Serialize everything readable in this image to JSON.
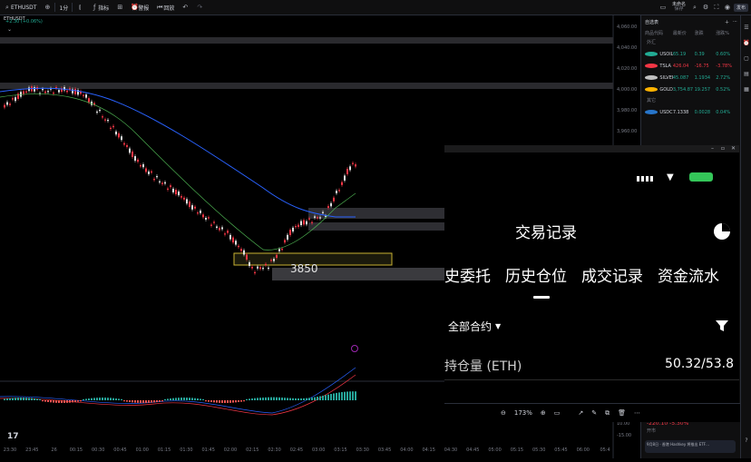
{
  "toolbar": {
    "symbol": "ETHUSDT",
    "interval": "1分",
    "indicators": "指标",
    "templates_icon": "grid-icon",
    "alert": "警报",
    "replay": "回放",
    "layout_name": "未命名",
    "layout_sub": "保存",
    "publish": "发布"
  },
  "chart": {
    "change_text": "+2.30 (+0.06%)",
    "price_axis": [
      "4,060.00",
      "4,040.00",
      "4,020.00",
      "4,000.00",
      "3,980.00",
      "3,960.00"
    ],
    "time_axis": [
      "23:30",
      "23:45",
      "26",
      "00:15",
      "00:30",
      "00:45",
      "01:00",
      "01:15",
      "01:30",
      "01:45",
      "02:00",
      "02:15",
      "02:30",
      "02:45",
      "03:00",
      "03:15",
      "03:30",
      "03:45",
      "04:00",
      "04:15",
      "04:30",
      "04:45",
      "05:00",
      "05:15",
      "05:30",
      "05:45",
      "06:00",
      "05:4"
    ],
    "annotation_level": "3850",
    "macd_axis": [
      "10.00",
      "-15.00"
    ],
    "logo": "17"
  },
  "watchlist": {
    "title": "自选表",
    "columns": [
      "商品代码",
      "最新价",
      "涨跌",
      "涨跌%"
    ],
    "group1": "外汇",
    "items": [
      {
        "symbol": "USOIL",
        "last": "65.19",
        "chg": "0.39",
        "chg_pct": "0.60%",
        "color": "#22ab94",
        "dir": "up"
      },
      {
        "symbol": "TSLA",
        "last": "426.04",
        "chg": "-16.75",
        "chg_pct": "-3.78%",
        "color": "#f23645",
        "dir": "down"
      },
      {
        "symbol": "SILVER",
        "last": "45.087",
        "chg": "1.1934",
        "chg_pct": "2.72%",
        "color": "#c0c0c0",
        "dir": "up"
      },
      {
        "symbol": "GOLD",
        "last": "3,754.87",
        "chg": "19.257",
        "chg_pct": "0.52%",
        "color": "#ffb300",
        "dir": "up"
      }
    ],
    "group2": "其它",
    "extra": {
      "symbol": "USDC",
      "last": "7.1338",
      "chg": "0.0028",
      "chg_pct": "0.04%",
      "color": "#2775ca"
    },
    "bottom_change": "-220.10  -5.30%",
    "bottom_sub": "开市",
    "news": "9月8日 · 香港 Hashkey 将推出 ETF…"
  },
  "phone": {
    "title": "交易记录",
    "tabs": [
      "史委托",
      "历史仓位",
      "成交记录",
      "资金流水"
    ],
    "active_tab": "历史仓位",
    "filter_label": "全部合约",
    "position_label": "持仓量 (ETH)",
    "position_value": "50.32/53.8"
  },
  "zoombar": {
    "zoom": "173%"
  }
}
